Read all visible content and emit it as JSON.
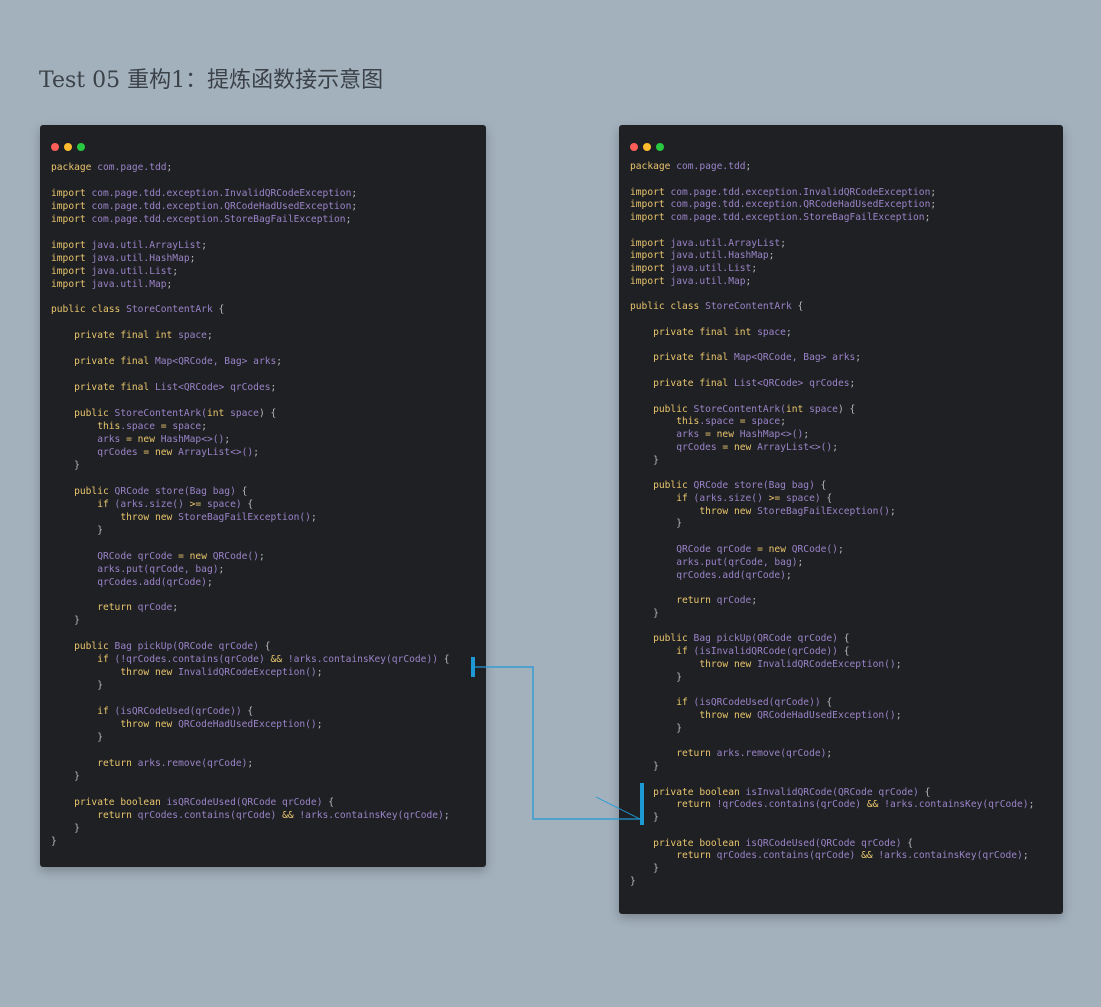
{
  "title": "Test 05 重构1：提炼函数接示意图",
  "colors": {
    "background": "#a3b1bd",
    "window": "#1f2023",
    "keyword": "#e8c56d",
    "identifier": "#9a83c8",
    "plain": "#b7b9bd",
    "highlight": "#1d9ad6"
  },
  "window_buttons": [
    "close",
    "minimize",
    "maximize"
  ],
  "window_button_colors": [
    "#ff5f57",
    "#febc2e",
    "#28c840"
  ],
  "left_code": [
    [
      [
        "kw",
        "package "
      ],
      [
        "ty",
        "com.page.tdd"
      ],
      [
        "pn",
        ";"
      ]
    ],
    [],
    [
      [
        "kw",
        "import "
      ],
      [
        "ty",
        "com.page.tdd.exception.InvalidQRCodeException"
      ],
      [
        "pn",
        ";"
      ]
    ],
    [
      [
        "kw",
        "import "
      ],
      [
        "ty",
        "com.page.tdd.exception.QRCodeHadUsedException"
      ],
      [
        "pn",
        ";"
      ]
    ],
    [
      [
        "kw",
        "import "
      ],
      [
        "ty",
        "com.page.tdd.exception.StoreBagFailException"
      ],
      [
        "pn",
        ";"
      ]
    ],
    [],
    [
      [
        "kw",
        "import "
      ],
      [
        "ty",
        "java.util.ArrayList"
      ],
      [
        "pn",
        ";"
      ]
    ],
    [
      [
        "kw",
        "import "
      ],
      [
        "ty",
        "java.util.HashMap"
      ],
      [
        "pn",
        ";"
      ]
    ],
    [
      [
        "kw",
        "import "
      ],
      [
        "ty",
        "java.util.List"
      ],
      [
        "pn",
        ";"
      ]
    ],
    [
      [
        "kw",
        "import "
      ],
      [
        "ty",
        "java.util.Map"
      ],
      [
        "pn",
        ";"
      ]
    ],
    [],
    [
      [
        "kw",
        "public class "
      ],
      [
        "ty",
        "StoreContentArk"
      ],
      [
        "pn",
        " {"
      ]
    ],
    [],
    [
      [
        "pn",
        "    "
      ],
      [
        "kw",
        "private final int "
      ],
      [
        "ty",
        "space"
      ],
      [
        "pn",
        ";"
      ]
    ],
    [],
    [
      [
        "pn",
        "    "
      ],
      [
        "kw",
        "private final "
      ],
      [
        "ty",
        "Map<QRCode, Bag> arks"
      ],
      [
        "pn",
        ";"
      ]
    ],
    [],
    [
      [
        "pn",
        "    "
      ],
      [
        "kw",
        "private final "
      ],
      [
        "ty",
        "List<QRCode> qrCodes"
      ],
      [
        "pn",
        ";"
      ]
    ],
    [],
    [
      [
        "pn",
        "    "
      ],
      [
        "kw",
        "public "
      ],
      [
        "ty",
        "StoreContentArk("
      ],
      [
        "kw",
        "int "
      ],
      [
        "ty",
        "space"
      ],
      [
        "pn",
        ") {"
      ]
    ],
    [
      [
        "pn",
        "        "
      ],
      [
        "kw",
        "this"
      ],
      [
        "ty",
        ".space"
      ],
      [
        "kw",
        " = "
      ],
      [
        "ty",
        "space"
      ],
      [
        "pn",
        ";"
      ]
    ],
    [
      [
        "pn",
        "        "
      ],
      [
        "ty",
        "arks"
      ],
      [
        "kw",
        " = new "
      ],
      [
        "ty",
        "HashMap<>()"
      ],
      [
        "pn",
        ";"
      ]
    ],
    [
      [
        "pn",
        "        "
      ],
      [
        "ty",
        "qrCodes"
      ],
      [
        "kw",
        " = new "
      ],
      [
        "ty",
        "ArrayList<>()"
      ],
      [
        "pn",
        ";"
      ]
    ],
    [
      [
        "pn",
        "    }"
      ]
    ],
    [],
    [
      [
        "pn",
        "    "
      ],
      [
        "kw",
        "public "
      ],
      [
        "ty",
        "QRCode store(Bag bag)"
      ],
      [
        "pn",
        " {"
      ]
    ],
    [
      [
        "pn",
        "        "
      ],
      [
        "kw",
        "if "
      ],
      [
        "ty",
        "(arks.size() "
      ],
      [
        "kw",
        ">="
      ],
      [
        "ty",
        " space)"
      ],
      [
        "pn",
        " {"
      ]
    ],
    [
      [
        "pn",
        "            "
      ],
      [
        "kw",
        "throw new "
      ],
      [
        "ty",
        "StoreBagFailException()"
      ],
      [
        "pn",
        ";"
      ]
    ],
    [
      [
        "pn",
        "        }"
      ]
    ],
    [],
    [
      [
        "pn",
        "        "
      ],
      [
        "ty",
        "QRCode qrCode"
      ],
      [
        "kw",
        " = new "
      ],
      [
        "ty",
        "QRCode()"
      ],
      [
        "pn",
        ";"
      ]
    ],
    [
      [
        "pn",
        "        "
      ],
      [
        "ty",
        "arks.put(qrCode, bag)"
      ],
      [
        "pn",
        ";"
      ]
    ],
    [
      [
        "pn",
        "        "
      ],
      [
        "ty",
        "qrCodes.add(qrCode)"
      ],
      [
        "pn",
        ";"
      ]
    ],
    [],
    [
      [
        "pn",
        "        "
      ],
      [
        "kw",
        "return "
      ],
      [
        "ty",
        "qrCode"
      ],
      [
        "pn",
        ";"
      ]
    ],
    [
      [
        "pn",
        "    }"
      ]
    ],
    [],
    [
      [
        "pn",
        "    "
      ],
      [
        "kw",
        "public "
      ],
      [
        "ty",
        "Bag pickUp(QRCode qrCode)"
      ],
      [
        "pn",
        " {"
      ]
    ],
    [
      [
        "pn",
        "        "
      ],
      [
        "kw",
        "if "
      ],
      [
        "ty",
        "(!qrCodes.contains(qrCode) "
      ],
      [
        "kw",
        "&&"
      ],
      [
        "ty",
        " !arks.containsKey(qrCode))"
      ],
      [
        "pn",
        " {"
      ]
    ],
    [
      [
        "pn",
        "            "
      ],
      [
        "kw",
        "throw new "
      ],
      [
        "ty",
        "InvalidQRCodeException()"
      ],
      [
        "pn",
        ";"
      ]
    ],
    [
      [
        "pn",
        "        }"
      ]
    ],
    [],
    [
      [
        "pn",
        "        "
      ],
      [
        "kw",
        "if "
      ],
      [
        "ty",
        "(isQRCodeUsed(qrCode))"
      ],
      [
        "pn",
        " {"
      ]
    ],
    [
      [
        "pn",
        "            "
      ],
      [
        "kw",
        "throw new "
      ],
      [
        "ty",
        "QRCodeHadUsedException()"
      ],
      [
        "pn",
        ";"
      ]
    ],
    [
      [
        "pn",
        "        }"
      ]
    ],
    [],
    [
      [
        "pn",
        "        "
      ],
      [
        "kw",
        "return "
      ],
      [
        "ty",
        "arks.remove(qrCode)"
      ],
      [
        "pn",
        ";"
      ]
    ],
    [
      [
        "pn",
        "    }"
      ]
    ],
    [],
    [
      [
        "pn",
        "    "
      ],
      [
        "kw",
        "private boolean "
      ],
      [
        "ty",
        "isQRCodeUsed(QRCode qrCode)"
      ],
      [
        "pn",
        " {"
      ]
    ],
    [
      [
        "pn",
        "        "
      ],
      [
        "kw",
        "return "
      ],
      [
        "ty",
        "qrCodes.contains(qrCode) "
      ],
      [
        "kw",
        "&&"
      ],
      [
        "ty",
        " !arks.containsKey(qrCode)"
      ],
      [
        "pn",
        ";"
      ]
    ],
    [
      [
        "pn",
        "    }"
      ]
    ],
    [
      [
        "pn",
        "}"
      ]
    ]
  ],
  "right_code": [
    [
      [
        "kw",
        "package "
      ],
      [
        "ty",
        "com.page.tdd"
      ],
      [
        "pn",
        ";"
      ]
    ],
    [],
    [
      [
        "kw",
        "import "
      ],
      [
        "ty",
        "com.page.tdd.exception.InvalidQRCodeException"
      ],
      [
        "pn",
        ";"
      ]
    ],
    [
      [
        "kw",
        "import "
      ],
      [
        "ty",
        "com.page.tdd.exception.QRCodeHadUsedException"
      ],
      [
        "pn",
        ";"
      ]
    ],
    [
      [
        "kw",
        "import "
      ],
      [
        "ty",
        "com.page.tdd.exception.StoreBagFailException"
      ],
      [
        "pn",
        ";"
      ]
    ],
    [],
    [
      [
        "kw",
        "import "
      ],
      [
        "ty",
        "java.util.ArrayList"
      ],
      [
        "pn",
        ";"
      ]
    ],
    [
      [
        "kw",
        "import "
      ],
      [
        "ty",
        "java.util.HashMap"
      ],
      [
        "pn",
        ";"
      ]
    ],
    [
      [
        "kw",
        "import "
      ],
      [
        "ty",
        "java.util.List"
      ],
      [
        "pn",
        ";"
      ]
    ],
    [
      [
        "kw",
        "import "
      ],
      [
        "ty",
        "java.util.Map"
      ],
      [
        "pn",
        ";"
      ]
    ],
    [],
    [
      [
        "kw",
        "public class "
      ],
      [
        "ty",
        "StoreContentArk"
      ],
      [
        "pn",
        " {"
      ]
    ],
    [],
    [
      [
        "pn",
        "    "
      ],
      [
        "kw",
        "private final int "
      ],
      [
        "ty",
        "space"
      ],
      [
        "pn",
        ";"
      ]
    ],
    [],
    [
      [
        "pn",
        "    "
      ],
      [
        "kw",
        "private final "
      ],
      [
        "ty",
        "Map<QRCode, Bag> arks"
      ],
      [
        "pn",
        ";"
      ]
    ],
    [],
    [
      [
        "pn",
        "    "
      ],
      [
        "kw",
        "private final "
      ],
      [
        "ty",
        "List<QRCode> qrCodes"
      ],
      [
        "pn",
        ";"
      ]
    ],
    [],
    [
      [
        "pn",
        "    "
      ],
      [
        "kw",
        "public "
      ],
      [
        "ty",
        "StoreContentArk("
      ],
      [
        "kw",
        "int "
      ],
      [
        "ty",
        "space"
      ],
      [
        "pn",
        ") {"
      ]
    ],
    [
      [
        "pn",
        "        "
      ],
      [
        "kw",
        "this"
      ],
      [
        "ty",
        ".space"
      ],
      [
        "kw",
        " = "
      ],
      [
        "ty",
        "space"
      ],
      [
        "pn",
        ";"
      ]
    ],
    [
      [
        "pn",
        "        "
      ],
      [
        "ty",
        "arks"
      ],
      [
        "kw",
        " = new "
      ],
      [
        "ty",
        "HashMap<>()"
      ],
      [
        "pn",
        ";"
      ]
    ],
    [
      [
        "pn",
        "        "
      ],
      [
        "ty",
        "qrCodes"
      ],
      [
        "kw",
        " = new "
      ],
      [
        "ty",
        "ArrayList<>()"
      ],
      [
        "pn",
        ";"
      ]
    ],
    [
      [
        "pn",
        "    }"
      ]
    ],
    [],
    [
      [
        "pn",
        "    "
      ],
      [
        "kw",
        "public "
      ],
      [
        "ty",
        "QRCode store(Bag bag)"
      ],
      [
        "pn",
        " {"
      ]
    ],
    [
      [
        "pn",
        "        "
      ],
      [
        "kw",
        "if "
      ],
      [
        "ty",
        "(arks.size() "
      ],
      [
        "kw",
        ">="
      ],
      [
        "ty",
        " space)"
      ],
      [
        "pn",
        " {"
      ]
    ],
    [
      [
        "pn",
        "            "
      ],
      [
        "kw",
        "throw new "
      ],
      [
        "ty",
        "StoreBagFailException()"
      ],
      [
        "pn",
        ";"
      ]
    ],
    [
      [
        "pn",
        "        }"
      ]
    ],
    [],
    [
      [
        "pn",
        "        "
      ],
      [
        "ty",
        "QRCode qrCode"
      ],
      [
        "kw",
        " = new "
      ],
      [
        "ty",
        "QRCode()"
      ],
      [
        "pn",
        ";"
      ]
    ],
    [
      [
        "pn",
        "        "
      ],
      [
        "ty",
        "arks.put(qrCode, bag)"
      ],
      [
        "pn",
        ";"
      ]
    ],
    [
      [
        "pn",
        "        "
      ],
      [
        "ty",
        "qrCodes.add(qrCode)"
      ],
      [
        "pn",
        ";"
      ]
    ],
    [],
    [
      [
        "pn",
        "        "
      ],
      [
        "kw",
        "return "
      ],
      [
        "ty",
        "qrCode"
      ],
      [
        "pn",
        ";"
      ]
    ],
    [
      [
        "pn",
        "    }"
      ]
    ],
    [],
    [
      [
        "pn",
        "    "
      ],
      [
        "kw",
        "public "
      ],
      [
        "ty",
        "Bag pickUp(QRCode qrCode)"
      ],
      [
        "pn",
        " {"
      ]
    ],
    [
      [
        "pn",
        "        "
      ],
      [
        "kw",
        "if "
      ],
      [
        "ty",
        "(isInvalidQRCode(qrCode))"
      ],
      [
        "pn",
        " {"
      ]
    ],
    [
      [
        "pn",
        "            "
      ],
      [
        "kw",
        "throw new "
      ],
      [
        "ty",
        "InvalidQRCodeException()"
      ],
      [
        "pn",
        ";"
      ]
    ],
    [
      [
        "pn",
        "        }"
      ]
    ],
    [],
    [
      [
        "pn",
        "        "
      ],
      [
        "kw",
        "if "
      ],
      [
        "ty",
        "(isQRCodeUsed(qrCode))"
      ],
      [
        "pn",
        " {"
      ]
    ],
    [
      [
        "pn",
        "            "
      ],
      [
        "kw",
        "throw new "
      ],
      [
        "ty",
        "QRCodeHadUsedException()"
      ],
      [
        "pn",
        ";"
      ]
    ],
    [
      [
        "pn",
        "        }"
      ]
    ],
    [],
    [
      [
        "pn",
        "        "
      ],
      [
        "kw",
        "return "
      ],
      [
        "ty",
        "arks.remove(qrCode)"
      ],
      [
        "pn",
        ";"
      ]
    ],
    [
      [
        "pn",
        "    }"
      ]
    ],
    [],
    [
      [
        "pn",
        "    "
      ],
      [
        "kw",
        "private boolean "
      ],
      [
        "ty",
        "isInvalidQRCode(QRCode qrCode)"
      ],
      [
        "pn",
        " {"
      ]
    ],
    [
      [
        "pn",
        "        "
      ],
      [
        "kw",
        "return "
      ],
      [
        "ty",
        "!qrCodes.contains(qrCode) "
      ],
      [
        "kw",
        "&&"
      ],
      [
        "ty",
        " !arks.containsKey(qrCode)"
      ],
      [
        "pn",
        ";"
      ]
    ],
    [
      [
        "pn",
        "    }"
      ]
    ],
    [],
    [
      [
        "pn",
        "    "
      ],
      [
        "kw",
        "private boolean "
      ],
      [
        "ty",
        "isQRCodeUsed(QRCode qrCode)"
      ],
      [
        "pn",
        " {"
      ]
    ],
    [
      [
        "pn",
        "        "
      ],
      [
        "kw",
        "return "
      ],
      [
        "ty",
        "qrCodes.contains(qrCode) "
      ],
      [
        "kw",
        "&&"
      ],
      [
        "ty",
        " !arks.containsKey(qrCode)"
      ],
      [
        "pn",
        ";"
      ]
    ],
    [
      [
        "pn",
        "    }"
      ]
    ],
    [
      [
        "pn",
        "}"
      ]
    ]
  ]
}
